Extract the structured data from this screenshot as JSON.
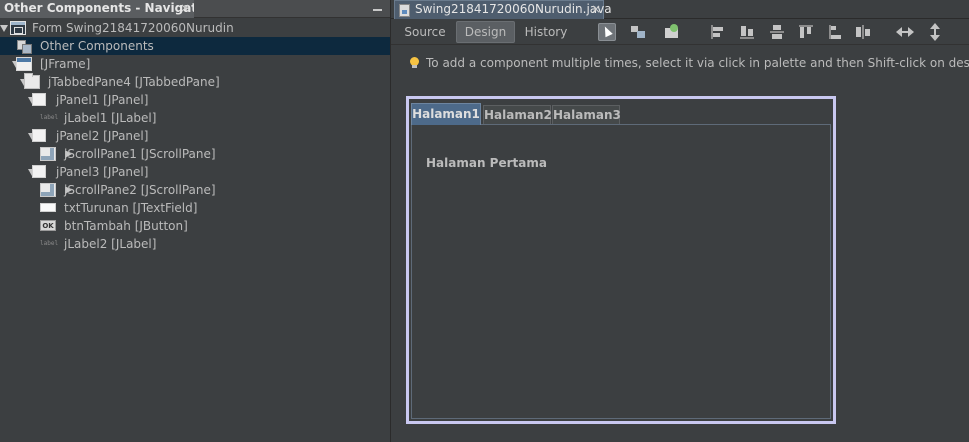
{
  "navigator": {
    "tab_title": "Other Components - Navigat...",
    "close_glyph": "×",
    "tree": [
      {
        "label": "Form Swing21841720060Nurudin",
        "icon": "form-icon",
        "indent": 0,
        "toggle": "down"
      },
      {
        "label": "Other Components",
        "icon": "other-components-icon",
        "indent": 1,
        "toggle": "none",
        "selected": true
      },
      {
        "label": "[JFrame]",
        "icon": "jframe-icon",
        "indent": 1,
        "toggle": "down"
      },
      {
        "label": "jTabbedPane4 [JTabbedPane]",
        "icon": "tabbed-pane-icon",
        "indent": 2,
        "toggle": "down"
      },
      {
        "label": "jPanel1 [JPanel]",
        "icon": "panel-icon",
        "indent": 3,
        "toggle": "down"
      },
      {
        "label": "jLabel1 [JLabel]",
        "icon": "label-icon",
        "indent": 4,
        "toggle": "none"
      },
      {
        "label": "jPanel2 [JPanel]",
        "icon": "panel-icon",
        "indent": 3,
        "toggle": "down"
      },
      {
        "label": "jScrollPane1 [JScrollPane]",
        "icon": "scroll-pane-icon",
        "indent": 4,
        "toggle": "right"
      },
      {
        "label": "jPanel3 [JPanel]",
        "icon": "panel-icon",
        "indent": 3,
        "toggle": "down"
      },
      {
        "label": "jScrollPane2 [JScrollPane]",
        "icon": "scroll-pane-icon",
        "indent": 4,
        "toggle": "right"
      },
      {
        "label": "txtTurunan [JTextField]",
        "icon": "text-field-icon",
        "indent": 4,
        "toggle": "none"
      },
      {
        "label": "btnTambah [JButton]",
        "icon": "button-icon",
        "indent": 4,
        "toggle": "none"
      },
      {
        "label": "jLabel2 [JLabel]",
        "icon": "label-icon",
        "indent": 4,
        "toggle": "none"
      }
    ]
  },
  "editor": {
    "file_tab": "Swing21841720060Nurudin.java",
    "close_glyph": "×",
    "views": {
      "source": "Source",
      "design": "Design",
      "history": "History",
      "active": "design"
    },
    "tools": [
      "selection-mode-icon",
      "connection-mode-icon",
      "preview-design-icon",
      "align-left-icon",
      "align-right-icon",
      "center-horizontally-icon",
      "align-top-icon",
      "align-bottom-icon",
      "center-vertically-icon",
      "resize-horizontal-icon",
      "resize-vertical-icon"
    ],
    "hint": "To add a component multiple times, select it via click in palette and then Shift-click on design canvas.",
    "canvas": {
      "tabs": [
        "Halaman1",
        "Halaman2",
        "Halaman3"
      ],
      "selected_tab": "Halaman1",
      "page_label": "Halaman Pertama"
    }
  },
  "colors": {
    "background": "#3c3f41",
    "selection": "#0d293e",
    "canvas_border": "#c9c8f0",
    "selected_tab": "#4d6a8a"
  }
}
